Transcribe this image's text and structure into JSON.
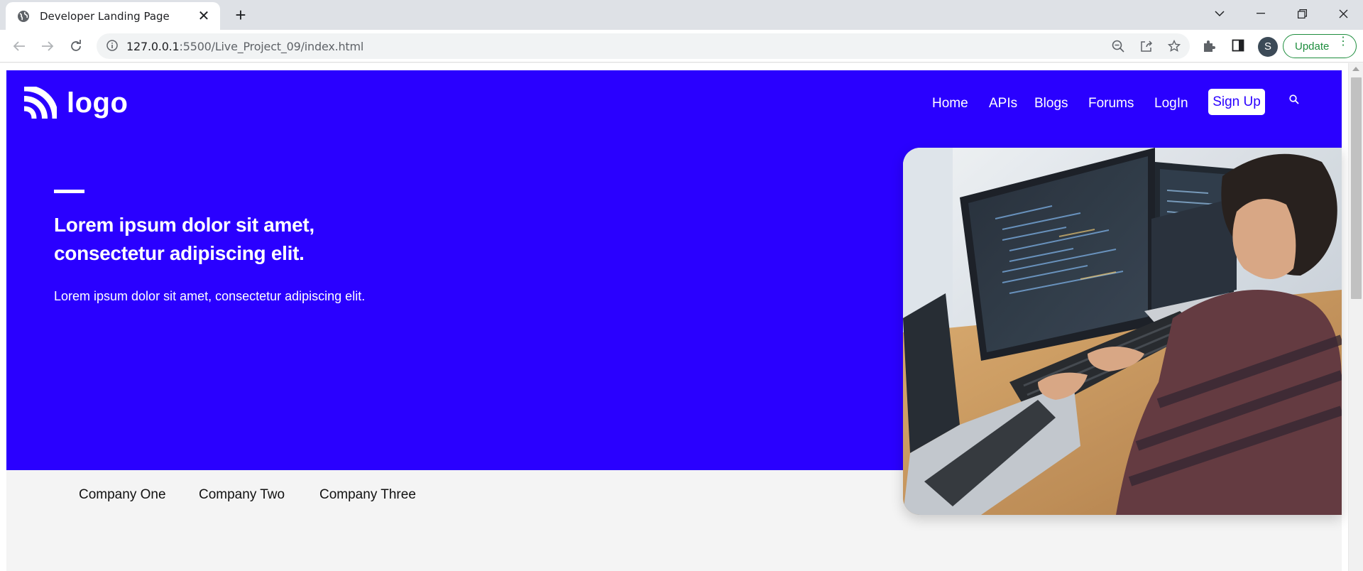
{
  "browser": {
    "tab_title": "Developer Landing Page",
    "url_host": "127.0.0.1",
    "url_rest": ":5500/Live_Project_09/index.html",
    "avatar_letter": "S",
    "update_label": "Update"
  },
  "header": {
    "logo_text": "logo",
    "nav": [
      "Home",
      "APIs",
      "Blogs",
      "Forums",
      "LogIn"
    ],
    "signup_label": "Sign Up"
  },
  "hero": {
    "headline_line1": "Lorem ipsum dolor sit amet,",
    "headline_line2": "consectetur adipiscing elit.",
    "subtext": "Lorem ipsum dolor sit amet, consectetur adipiscing elit."
  },
  "companies": [
    "Company One",
    "Company Two",
    "Company Three"
  ],
  "colors": {
    "hero_blue": "#2a00ff",
    "page_bg": "#f4f4f4",
    "update_green": "#1e8e3e"
  },
  "icons": {
    "tab": "globe-icon",
    "search": "search-icon",
    "logo_mark": "rss-feed-icon"
  }
}
